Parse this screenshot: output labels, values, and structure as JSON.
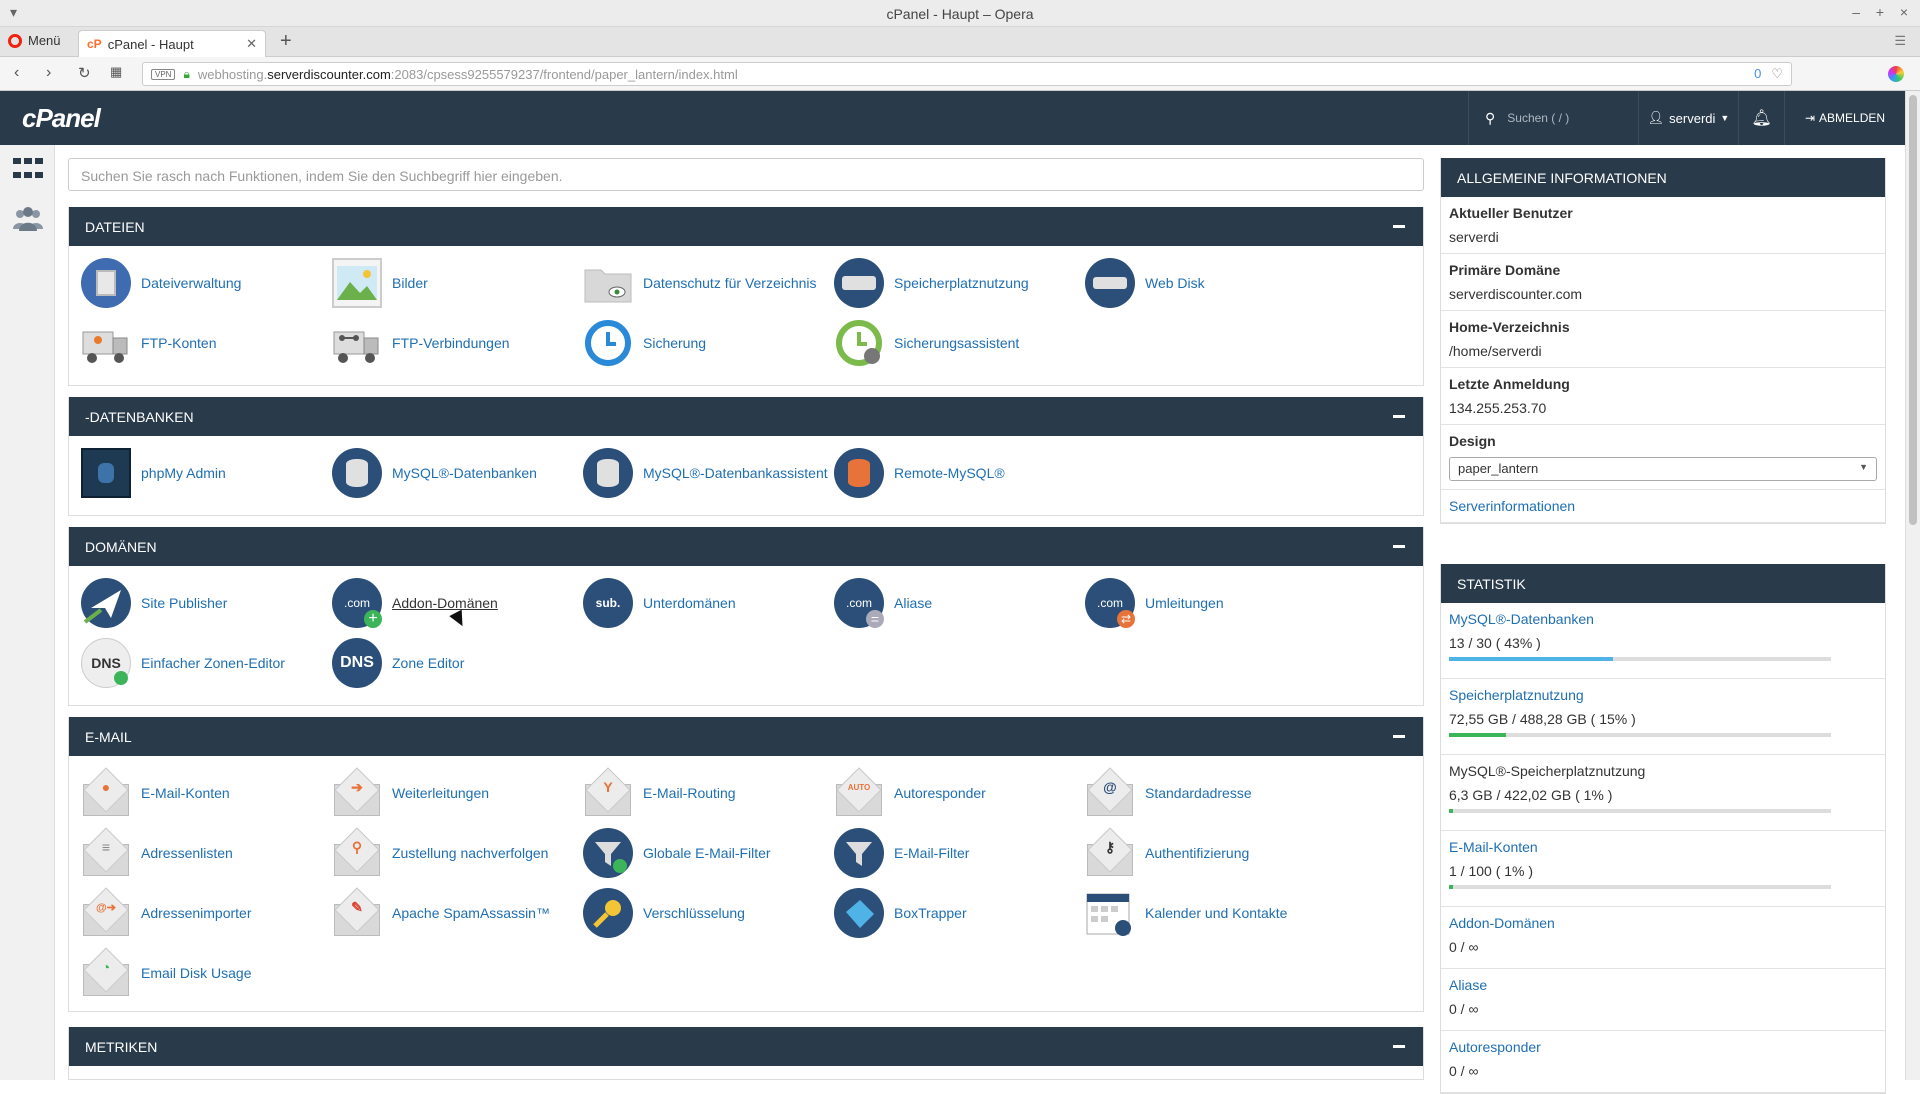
{
  "browser": {
    "window_title": "cPanel - Haupt – Opera",
    "menu_label": "Menü",
    "tab_title": "cPanel - Haupt",
    "url_prefix": "webhosting.",
    "url_host": "serverdiscounter.com",
    "url_rest": ":2083/cpsess9255579237/frontend/paper_lantern/index.html",
    "vpn_label": "VPN",
    "adblock_count": "0"
  },
  "header": {
    "logo": "cPanel",
    "search_placeholder": "Suchen ( / )",
    "user": "serverdi",
    "logout": "ABMELDEN"
  },
  "quick_search_placeholder": "Suchen Sie rasch nach Funktionen, indem Sie den Suchbegriff hier eingeben.",
  "sections": {
    "dateien": {
      "title": "DATEIEN",
      "items": [
        "Dateiverwaltung",
        "Bilder",
        "Datenschutz für Verzeichnis",
        "Speicherplatznutzung",
        "Web Disk",
        "FTP-Konten",
        "FTP-Verbindungen",
        "Sicherung",
        "Sicherungsassistent"
      ]
    },
    "datenbanken": {
      "title": "-DATENBANKEN",
      "items": [
        "phpMy Admin",
        "MySQL®-Datenbanken",
        "MySQL®-Datenbankassistent",
        "Remote-MySQL®"
      ]
    },
    "domaenen": {
      "title": "DOMÄNEN",
      "items": [
        "Site Publisher",
        "Addon-Domänen",
        "Unterdomänen",
        "Aliase",
        "Umleitungen",
        "Einfacher Zonen-Editor",
        "Zone Editor"
      ]
    },
    "email": {
      "title": "E-MAIL",
      "items": [
        "E-Mail-Konten",
        "Weiterleitungen",
        "E-Mail-Routing",
        "Autoresponder",
        "Standardadresse",
        "Adressenlisten",
        "Zustellung nachverfolgen",
        "Globale E-Mail-Filter",
        "E-Mail-Filter",
        "Authentifizierung",
        "Adressenimporter",
        "Apache SpamAssassin™",
        "Verschlüsselung",
        "BoxTrapper",
        "Kalender und Kontakte",
        "Email Disk Usage"
      ]
    },
    "metriken": {
      "title": "METRIKEN"
    }
  },
  "icon_glyphs": {
    "com": ".com",
    "sub": "sub.",
    "dns": "DNS",
    "auto": "AUTO"
  },
  "info": {
    "title": "ALLGEMEINE INFORMATIONEN",
    "current_user_label": "Aktueller Benutzer",
    "current_user": "serverdi",
    "primary_domain_label": "Primäre Domäne",
    "primary_domain": "serverdiscounter.com",
    "home_dir_label": "Home-Verzeichnis",
    "home_dir": "/home/serverdi",
    "last_login_label": "Letzte Anmeldung",
    "last_login": "134.255.253.70",
    "design_label": "Design",
    "design_value": "paper_lantern",
    "server_info_link": "Serverinformationen"
  },
  "stats": {
    "title": "STATISTIK",
    "items": [
      {
        "name": "MySQL®-Datenbanken",
        "value": "13 / 30 ( 43% )",
        "fraction": 0.43,
        "color": "#4fb3e8"
      },
      {
        "name": "Speicherplatznutzung",
        "value": "72,55 GB / 488,28 GB ( 15% )",
        "fraction": 0.15,
        "color": "#3cb55a"
      },
      {
        "name": "MySQL®-Speicherplatznutzung",
        "value": "6,3 GB / 422,02 GB ( 1% )",
        "fraction": 0.01,
        "color": "#3cb55a"
      },
      {
        "name": "E-Mail-Konten",
        "value": "1 / 100 ( 1% )",
        "fraction": 0.01,
        "color": "#3cb55a"
      },
      {
        "name": "Addon-Domänen",
        "value": "0 / ∞"
      },
      {
        "name": "Aliase",
        "value": "0 / ∞"
      },
      {
        "name": "Autoresponder",
        "value": "0 / ∞"
      }
    ]
  },
  "colors": {
    "header_bg": "#293a4a",
    "link": "#1f6fb3",
    "accent_orange": "#ff6c2c"
  }
}
